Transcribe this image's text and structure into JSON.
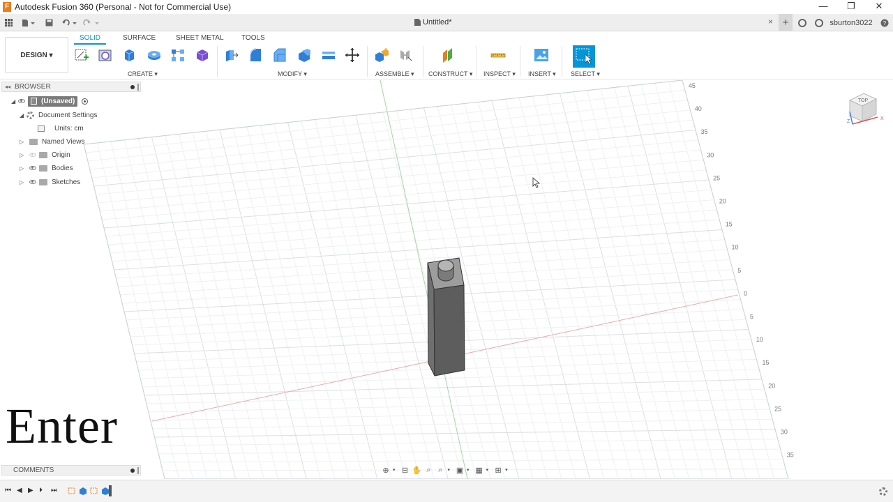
{
  "window": {
    "title": "Autodesk Fusion 360 (Personal - Not for Commercial Use)",
    "app_icon_letter": "F",
    "minimize_glyph": "—",
    "maximize_glyph": "❐",
    "close_glyph": "✕"
  },
  "tabstrip": {
    "document_tab": "Untitled*",
    "close_glyph": "×",
    "new_tab_glyph": "+",
    "username": "sburton3022",
    "help_glyph": "?"
  },
  "toolbar": {
    "workspace_button": "DESIGN ▾",
    "tabs": [
      "SOLID",
      "SURFACE",
      "SHEET METAL",
      "TOOLS"
    ],
    "active_tab": "SOLID",
    "groups": {
      "create": "CREATE ▾",
      "modify": "MODIFY ▾",
      "assemble": "ASSEMBLE ▾",
      "construct": "CONSTRUCT ▾",
      "inspect": "INSPECT ▾",
      "insert": "INSERT ▾",
      "select": "SELECT ▾"
    },
    "accent_color": "#0696d7"
  },
  "browser": {
    "header": "BROWSER",
    "root": "(Unsaved)",
    "items": [
      {
        "label": "Document Settings"
      },
      {
        "label": "Units: cm"
      },
      {
        "label": "Named Views"
      },
      {
        "label": "Origin"
      },
      {
        "label": "Bodies"
      },
      {
        "label": "Sketches"
      }
    ]
  },
  "comments": {
    "header": "COMMENTS"
  },
  "overlay": {
    "text": "Enter"
  },
  "viewcube": {
    "face": "TOP",
    "x_axis": "X",
    "z_axis": "Z"
  },
  "ruler": {
    "labels": [
      "45",
      "40",
      "35",
      "30",
      "25",
      "20",
      "15",
      "10",
      "5",
      "0",
      "5",
      "10",
      "15",
      "20",
      "25",
      "30",
      "35"
    ]
  }
}
